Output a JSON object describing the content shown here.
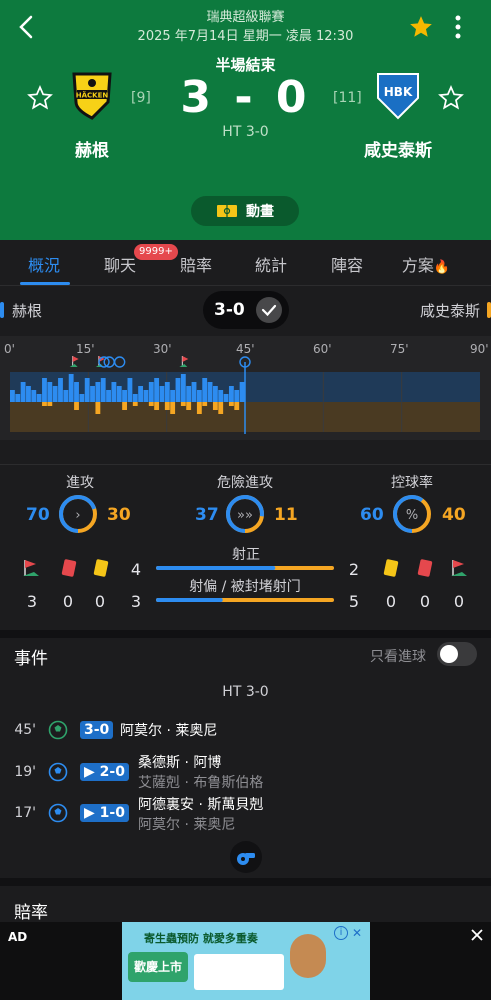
{
  "header": {
    "league": "瑞典超級聯賽",
    "datetime": "2025 年7月14日 星期一 凌晨 12:30",
    "status": "半場結束",
    "score": "3 - 0",
    "halftime": "HT 3-0",
    "home": {
      "name": "赫根",
      "rank": "[9]",
      "logo_text": "HÄCKEN"
    },
    "away": {
      "name": "咸史泰斯",
      "rank": "[11]",
      "logo_text": "HBK"
    },
    "animation_label": "動畫",
    "colors": {
      "header_bg": "#0d7a3e",
      "favorite_star": "#f5b800"
    }
  },
  "tabs": [
    {
      "label": "概況",
      "active": true
    },
    {
      "label": "聊天",
      "badge": "9999+"
    },
    {
      "label": "賠率"
    },
    {
      "label": "統計"
    },
    {
      "label": "陣容"
    },
    {
      "label": "方案",
      "icon": "fire-icon"
    }
  ],
  "timeline": {
    "home_name": "赫根",
    "away_name": "咸史泰斯",
    "score": "3-0",
    "minute_labels": [
      "0'",
      "15'",
      "30'",
      "45'",
      "60'",
      "75'",
      "90'"
    ],
    "current_minute": 45,
    "events": [
      {
        "minute": 12,
        "type": "corner"
      },
      {
        "minute": 17,
        "type": "corner"
      },
      {
        "minute": 18,
        "type": "goal"
      },
      {
        "minute": 19,
        "type": "goal"
      },
      {
        "minute": 21,
        "type": "goal"
      },
      {
        "minute": 33,
        "type": "corner"
      },
      {
        "minute": 45,
        "type": "goal"
      }
    ],
    "home_pressure": [
      3,
      2,
      5,
      4,
      3,
      2,
      6,
      5,
      4,
      6,
      3,
      7,
      5,
      2,
      6,
      4,
      5,
      6,
      3,
      5,
      4,
      3,
      6,
      2,
      4,
      3,
      5,
      6,
      4,
      5,
      3,
      6,
      7,
      4,
      5,
      3,
      6,
      5,
      4,
      3,
      2,
      4,
      3,
      5
    ],
    "away_pressure": [
      0,
      0,
      0,
      0,
      0,
      0,
      1,
      1,
      0,
      0,
      0,
      0,
      2,
      0,
      0,
      0,
      3,
      0,
      0,
      0,
      0,
      2,
      0,
      1,
      0,
      0,
      1,
      2,
      0,
      2,
      3,
      0,
      1,
      2,
      0,
      3,
      1,
      0,
      2,
      3,
      0,
      1,
      2,
      0
    ],
    "colors": {
      "home": "#2d8cf0",
      "away": "#f5a623"
    }
  },
  "stats": {
    "rings": [
      {
        "title": "進攻",
        "home": "70",
        "away": "30",
        "home_frac": 0.7,
        "icon": "chevron-right-icon"
      },
      {
        "title": "危險進攻",
        "home": "37",
        "away": "11",
        "home_frac": 0.77,
        "icon": "triple-chevron-icon"
      },
      {
        "title": "控球率",
        "home": "60",
        "away": "40",
        "home_frac": 0.6,
        "icon": "percent-icon"
      }
    ],
    "bars": [
      {
        "label": "射正",
        "home": "4",
        "away": "2",
        "home_frac": 0.67
      },
      {
        "label": "射偏 / 被封堵射门",
        "home": "3",
        "away": "5",
        "home_frac": 0.375
      }
    ],
    "home_cards": {
      "corners": "3",
      "red": "0",
      "yellow": "0"
    },
    "away_cards": {
      "yellow": "0",
      "red": "0",
      "corners": "0"
    }
  },
  "events": {
    "title": "事件",
    "filter_label": "只看進球",
    "ht_label": "HT 3-0",
    "items": [
      {
        "minute": "45'",
        "score": "3-0",
        "player": "阿莫尔 · 莱奥尼",
        "assist": "",
        "arrow": false
      },
      {
        "minute": "19'",
        "score": "▶ 2-0",
        "player": "桑德斯 · 阿博",
        "assist": "艾薩剋 · 布鲁斯伯格",
        "arrow": true
      },
      {
        "minute": "17'",
        "score": "▶ 1-0",
        "player": "阿德裏安 · 斯萬貝剋",
        "assist": "阿莫尔 · 莱奥尼",
        "arrow": true
      }
    ]
  },
  "odds": {
    "title": "賠率"
  },
  "ad": {
    "label": "AD",
    "headline": "寄生蟲預防 就愛多重奏",
    "sub": "歡慶上市"
  }
}
